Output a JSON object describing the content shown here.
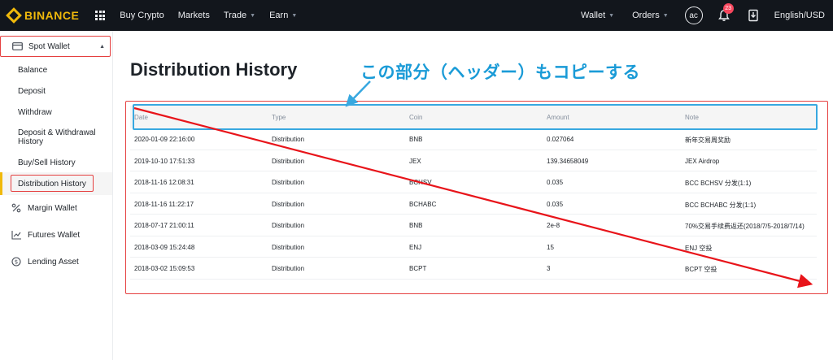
{
  "topbar": {
    "logo": "BINANCE",
    "nav": [
      "Buy Crypto",
      "Markets",
      "Trade",
      "Earn"
    ],
    "right": {
      "wallet": "Wallet",
      "orders": "Orders",
      "avatar": "ac",
      "notifications": "23",
      "language": "English/USD"
    }
  },
  "sidebar": {
    "spot_wallet": "Spot Wallet",
    "items": [
      "Balance",
      "Deposit",
      "Withdraw",
      "Deposit & Withdrawal History",
      "Buy/Sell History",
      "Distribution History"
    ],
    "margin": "Margin Wallet",
    "futures": "Futures Wallet",
    "lending": "Lending Asset"
  },
  "page": {
    "title": "Distribution History",
    "annotation": "この部分（ヘッダー）もコピーする"
  },
  "table": {
    "headers": [
      "Date",
      "Type",
      "Coin",
      "Amount",
      "Note"
    ],
    "rows": [
      [
        "2020-01-09 22:16:00",
        "Distribution",
        "BNB",
        "0.027064",
        "新年交易周奖励"
      ],
      [
        "2019-10-10 17:51:33",
        "Distribution",
        "JEX",
        "139.34658049",
        "JEX Airdrop"
      ],
      [
        "2018-11-16 12:08:31",
        "Distribution",
        "BCHSV",
        "0.035",
        "BCC BCHSV 分发(1:1)"
      ],
      [
        "2018-11-16 11:22:17",
        "Distribution",
        "BCHABC",
        "0.035",
        "BCC BCHABC 分发(1:1)"
      ],
      [
        "2018-07-17 21:00:11",
        "Distribution",
        "BNB",
        "2e-8",
        "70%交易手续费返还(2018/7/5-2018/7/14)"
      ],
      [
        "2018-03-09 15:24:48",
        "Distribution",
        "ENJ",
        "15",
        "ENJ 空投"
      ],
      [
        "2018-03-02 15:09:53",
        "Distribution",
        "BCPT",
        "3",
        "BCPT 空投"
      ]
    ]
  },
  "colors": {
    "topbar": "#12161c",
    "brand": "#f0b90b",
    "annotation_red": "#e54040",
    "annotation_blue": "#38a8e0"
  }
}
